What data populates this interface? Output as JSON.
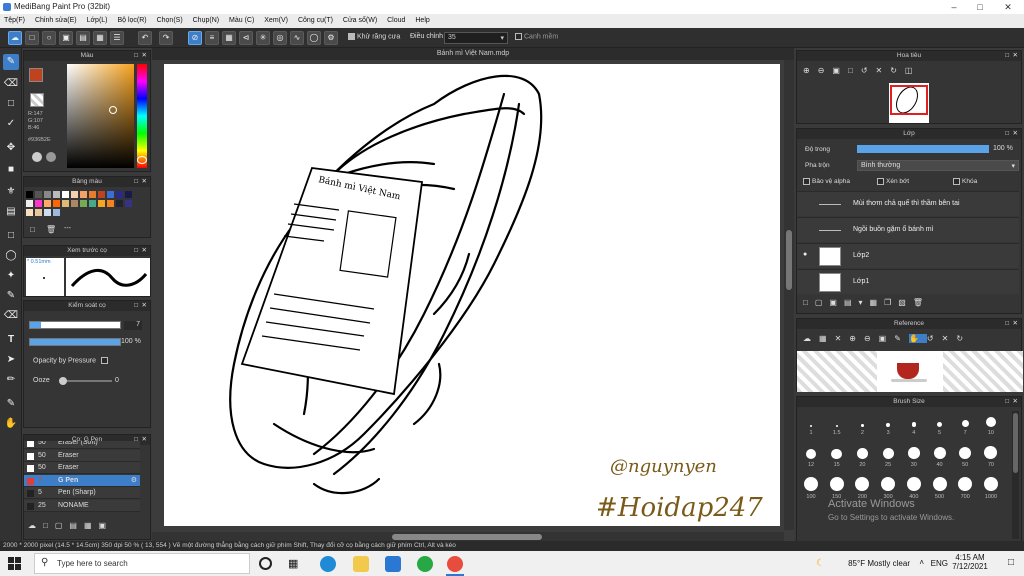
{
  "window": {
    "title": "MediBang Paint Pro (32bit)"
  },
  "menu": [
    "Tệp(F)",
    "Chỉnh sửa(E)",
    "Lớp(L)",
    "Bộ lọc(R)",
    "Chọn(S)",
    "Chụp(N)",
    "Màu (C)",
    "Xem(V)",
    "Công cụ(T)",
    "Cửa sổ(W)",
    "Cloud",
    "Help"
  ],
  "toolbar": {
    "anti_alias_label": "Khử răng cưa",
    "smooth_label": "Điều chỉnh",
    "smooth_value": "35",
    "snap_label": "Canh mềm"
  },
  "canvas": {
    "tab_title": "Bánh mì Việt Nam.mdp",
    "sign_text": "@nguynyen",
    "hashtag_text": "#Hoidap247",
    "paper_text": "Bánh mì Việt Nam"
  },
  "color_panel": {
    "title": "Màu",
    "r": "R:147",
    "g": "G:107",
    "b": "B:46",
    "hex": "#936B2E",
    "fg_color": "#c0431f"
  },
  "palette_panel": {
    "title": "Bảng màu"
  },
  "preview_panel": {
    "title": "Xem trước cọ",
    "size_label": "* 0.51mm"
  },
  "brush_control": {
    "title": "Kiểm soát cọ",
    "width_value": "7",
    "opacity_value": "100 %",
    "pressure_label": "Opacity by Pressure",
    "ooze_label": "Ooze",
    "ooze_value": "0"
  },
  "brush_list": {
    "title": "Cọ: G Pen",
    "items": [
      {
        "size": "50",
        "name": "Eraser (Soft)",
        "color": "#ffffff",
        "selected": false
      },
      {
        "size": "50",
        "name": "Eraser",
        "color": "#ffffff",
        "selected": false
      },
      {
        "size": "50",
        "name": "Eraser",
        "color": "#ffffff",
        "selected": false
      },
      {
        "size": "7",
        "name": "G Pen",
        "color": "#e23b3b",
        "selected": true
      },
      {
        "size": "5",
        "name": "Pen (Sharp)",
        "color": "#222222",
        "selected": false
      },
      {
        "size": "25",
        "name": "NONAME",
        "color": "#222222",
        "selected": false
      }
    ]
  },
  "navigator": {
    "title": "Hoa tiêu"
  },
  "layer_panel": {
    "title": "Lớp",
    "opacity_label": "Độ trong",
    "opacity_value": "100 %",
    "blend_label": "Pha trộn",
    "blend_value": "Bình thường",
    "protect_alpha": "Bảo vệ alpha",
    "clipping": "Xén bớt",
    "lock": "Khóa",
    "layers": [
      {
        "name": "Mùi thơm chả quế thì thầm bên tai",
        "type": "text"
      },
      {
        "name": "Ngồi buồn gặm ổ bánh mì",
        "type": "text"
      },
      {
        "name": "Lớp2",
        "type": "raster"
      },
      {
        "name": "Lớp1",
        "type": "raster"
      }
    ]
  },
  "reference": {
    "title": "Reference"
  },
  "brush_size": {
    "title": "Brush Size",
    "row1": [
      "1",
      "1.5",
      "2",
      "3",
      "4",
      "5",
      "7",
      "10"
    ],
    "row2": [
      "12",
      "15",
      "20",
      "25",
      "30",
      "40",
      "50",
      "70"
    ],
    "row3": [
      "100",
      "150",
      "200",
      "300",
      "400",
      "500",
      "700",
      "1000"
    ]
  },
  "activate": {
    "line1": "Activate Windows",
    "line2": "Go to Settings to activate Windows."
  },
  "status": {
    "text": "2000 * 2000 pixel   (14.5 * 14.5cm)   350 dpi   50 %   ( 13, 554 )   Vẽ một đường thẳng bằng cách giữ phím Shift, Thay đổi cỡ cọ bằng cách giữ phím Ctrl, Alt và kéo"
  },
  "taskbar": {
    "search_placeholder": "Type here to search",
    "weather": "85°F  Mostly clear",
    "lang": "ENG",
    "time": "4:15 AM",
    "date": "7/12/2021"
  }
}
